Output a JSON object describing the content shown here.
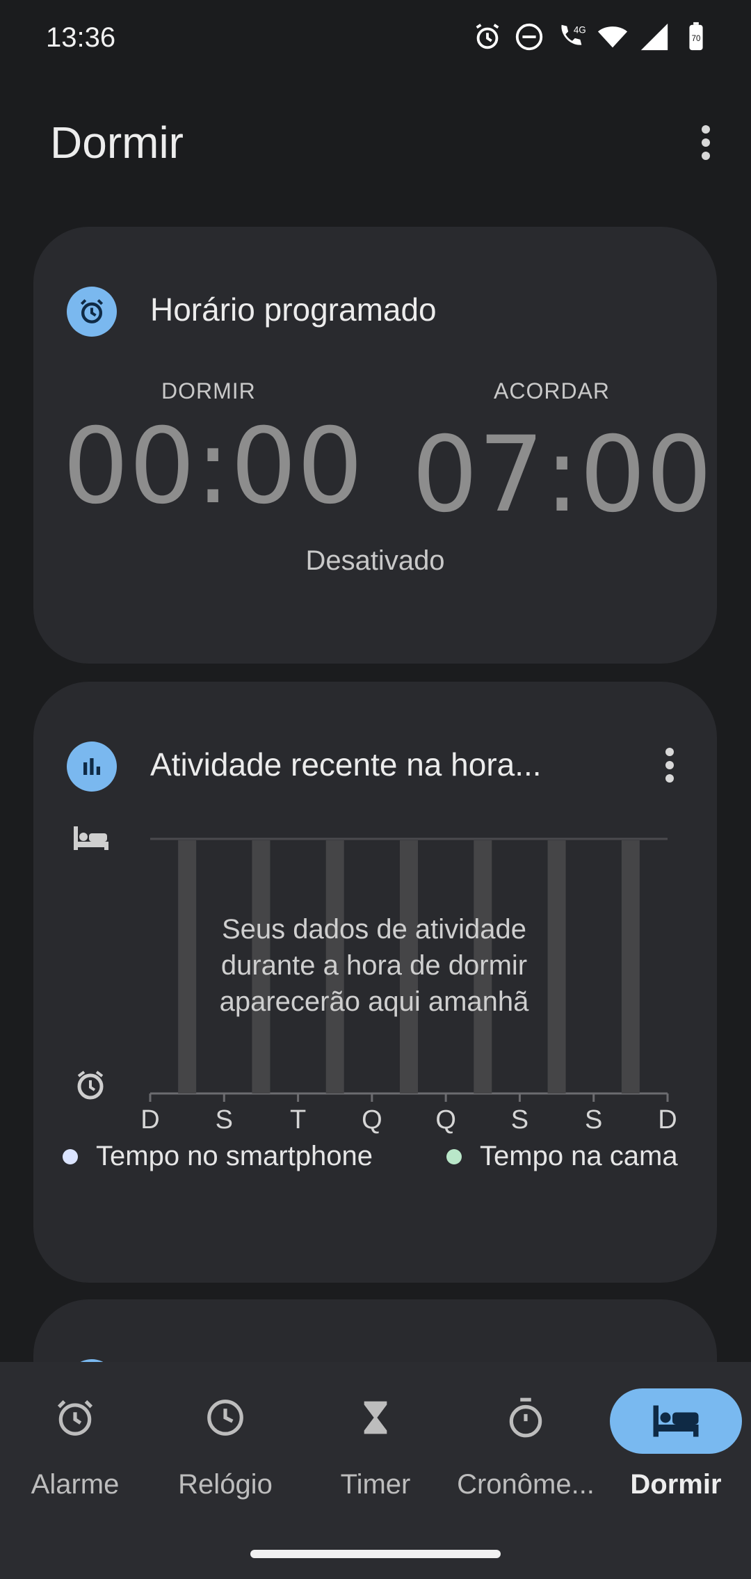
{
  "status": {
    "time": "13:36",
    "network": "4G",
    "battery": "70"
  },
  "appbar": {
    "title": "Dormir"
  },
  "schedule": {
    "title": "Horário programado",
    "bedtime_label": "DORMIR",
    "bedtime_value": "00:00",
    "wake_label": "ACORDAR",
    "wake_value": "07:00",
    "state": "Desativado"
  },
  "activity": {
    "title": "Atividade recente na hora...",
    "empty_message_lines": [
      "Seus dados de atividade",
      "durante a hora de dormir",
      "aparecerão aqui amanhã"
    ],
    "legend": [
      {
        "label": "Tempo no smartphone",
        "color": "#dbe4ff"
      },
      {
        "label": "Tempo na cama",
        "color": "#b9e7c9"
      }
    ]
  },
  "chart_data": {
    "type": "bar",
    "categories": [
      "D",
      "S",
      "T",
      "Q",
      "Q",
      "S",
      "S",
      "D"
    ],
    "values": [],
    "series": []
  },
  "nav": {
    "items": [
      {
        "label": "Alarme",
        "icon": "alarm-icon",
        "active": false
      },
      {
        "label": "Relógio",
        "icon": "clock-icon",
        "active": false
      },
      {
        "label": "Timer",
        "icon": "hourglass-icon",
        "active": false
      },
      {
        "label": "Cronôme...",
        "icon": "stopwatch-icon",
        "active": false
      },
      {
        "label": "Dormir",
        "icon": "bed-icon",
        "active": true
      }
    ]
  },
  "colors": {
    "accent": "#79b9f0",
    "card": "#292a2e",
    "background": "#1b1c1e"
  }
}
